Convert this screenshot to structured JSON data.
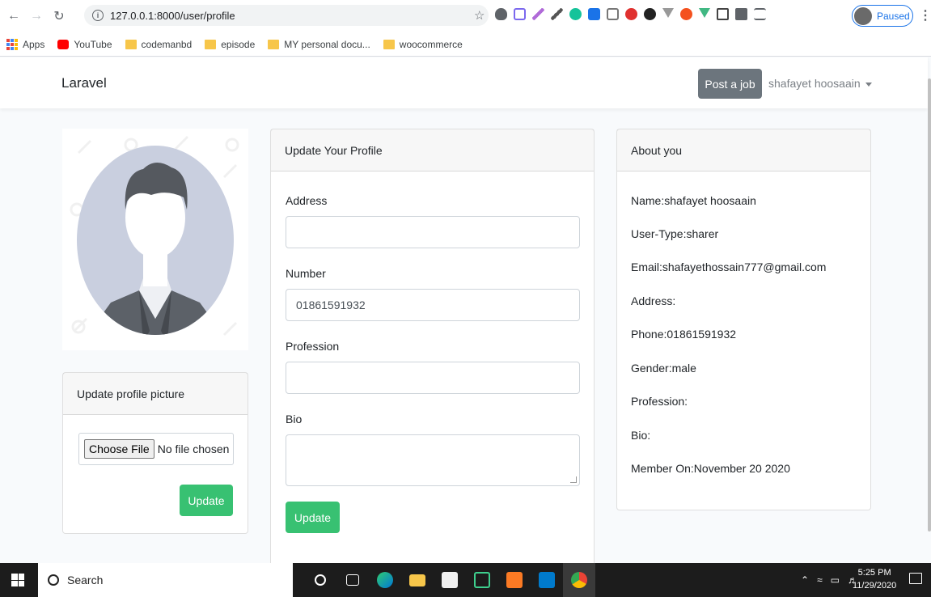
{
  "browser": {
    "url": "127.0.0.1:8000/user/profile",
    "paused_label": "Paused",
    "bookmarks": [
      {
        "label": "Apps",
        "icon": "apps-grid-icon"
      },
      {
        "label": "YouTube",
        "icon": "youtube-icon"
      },
      {
        "label": "codemanbd",
        "icon": "folder-icon"
      },
      {
        "label": "episode",
        "icon": "folder-icon"
      },
      {
        "label": "MY personal docu...",
        "icon": "folder-icon"
      },
      {
        "label": "woocommerce",
        "icon": "folder-icon"
      }
    ]
  },
  "navbar": {
    "brand": "Laravel",
    "post_job": "Post a job",
    "user": "shafayet hoosaain"
  },
  "picture_card": {
    "header": "Update profile picture",
    "choose_file": "Choose File",
    "no_file": "No file chosen",
    "update": "Update"
  },
  "form": {
    "header": "Update Your Profile",
    "address_label": "Address",
    "address_value": "",
    "number_label": "Number",
    "number_value": "01861591932",
    "profession_label": "Profession",
    "profession_value": "",
    "bio_label": "Bio",
    "update": "Update"
  },
  "about": {
    "header": "About you",
    "lines": [
      "Name:shafayet hoosaain",
      "User-Type:sharer",
      "Email:shafayethossain777@gmail.com",
      "Address:",
      "Phone:01861591932",
      "Gender:male",
      "Profession:",
      "Bio:",
      "Member On:November 20 2020"
    ]
  },
  "taskbar": {
    "search_placeholder": "Search",
    "time": "5:25 PM",
    "date": "11/29/2020"
  },
  "colors": {
    "accent_green": "#38c172",
    "post_job_bg": "#6c757d"
  }
}
